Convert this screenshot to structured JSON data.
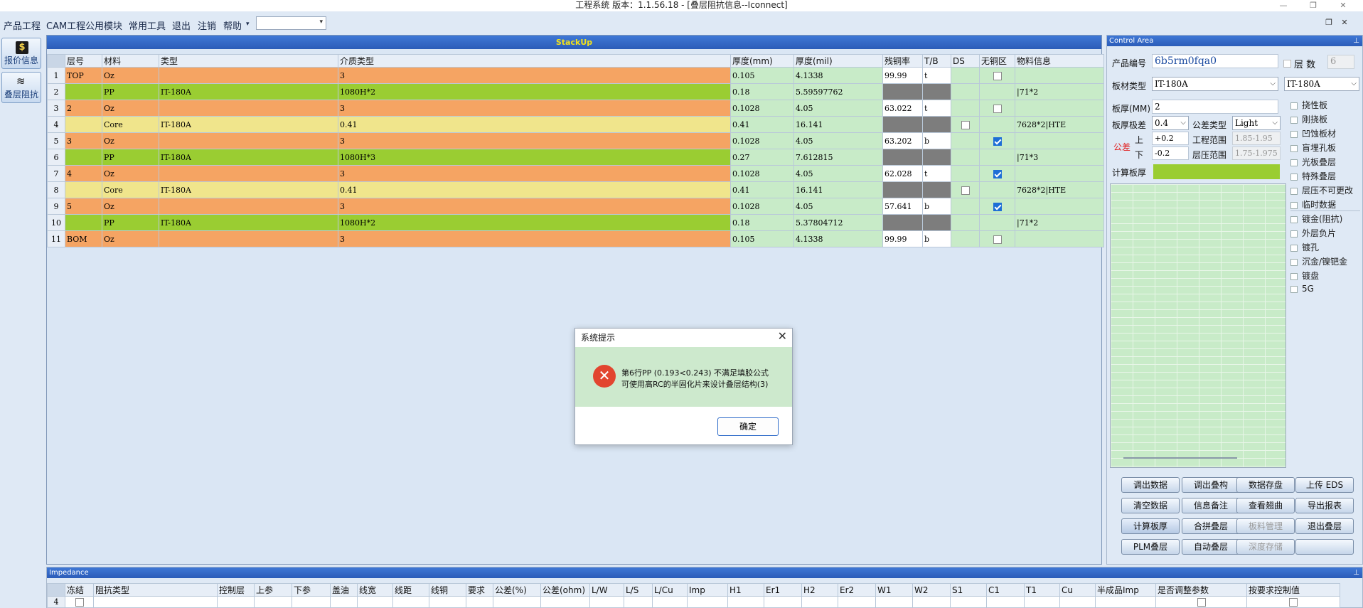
{
  "window": {
    "title": "工程系统   版本：1.1.56.18 - [叠层阻抗信息--Iconnect]",
    "controls": {
      "minimize": "—",
      "restore": "❐",
      "close": "✕"
    }
  },
  "menu": {
    "items": [
      "产品工程",
      "CAM工程",
      "公用模块",
      "常用工具",
      "退出",
      "注销",
      "帮助"
    ],
    "overflow": "▾",
    "combo_value": "",
    "mdi": {
      "restore": "❐",
      "close": "✕"
    }
  },
  "side": {
    "quote_label": "报价信息",
    "quote_icon": "$",
    "stack_label": "叠层阻抗",
    "stack_icon": "≋"
  },
  "stackup": {
    "title": "StackUp",
    "columns": [
      "层号",
      "材料",
      "类型",
      "介质类型",
      "厚度(mm)",
      "厚度(mil)",
      "残铜率",
      "T/B",
      "DS",
      "无铜区",
      "物料信息"
    ],
    "rows": [
      {
        "idx": "1",
        "layer": "TOP",
        "mat": "Oz",
        "type": "",
        "med": "3",
        "mm": "0.105",
        "mil": "4.1338",
        "res": "99.99",
        "tb": "t",
        "ds": "",
        "nocu": "off",
        "info": "",
        "kind": "cu"
      },
      {
        "idx": "2",
        "layer": "",
        "mat": "PP",
        "type": "IT-180A",
        "med": "1080H*2",
        "mm": "0.18",
        "mil": "5.59597762",
        "res": "",
        "tb": "",
        "ds": "",
        "nocu": "",
        "info": "|71*2",
        "kind": "pp"
      },
      {
        "idx": "3",
        "layer": "2",
        "mat": "Oz",
        "type": "",
        "med": "3",
        "mm": "0.1028",
        "mil": "4.05",
        "res": "63.022",
        "tb": "t",
        "ds": "",
        "nocu": "off",
        "info": "",
        "kind": "cu"
      },
      {
        "idx": "4",
        "layer": "",
        "mat": "Core",
        "type": "IT-180A",
        "med": "0.41",
        "mm": "0.41",
        "mil": "16.141",
        "res": "",
        "tb": "",
        "ds": "off",
        "nocu": "",
        "info": "7628*2|HTE",
        "kind": "core"
      },
      {
        "idx": "5",
        "layer": "3",
        "mat": "Oz",
        "type": "",
        "med": "3",
        "mm": "0.1028",
        "mil": "4.05",
        "res": "63.202",
        "tb": "b",
        "ds": "",
        "nocu": "on",
        "info": "",
        "kind": "cu"
      },
      {
        "idx": "6",
        "layer": "",
        "mat": "PP",
        "type": "IT-180A",
        "med": "1080H*3",
        "mm": "0.27",
        "mil": "7.612815",
        "res": "",
        "tb": "",
        "ds": "",
        "nocu": "",
        "info": "|71*3",
        "kind": "pp"
      },
      {
        "idx": "7",
        "layer": "4",
        "mat": "Oz",
        "type": "",
        "med": "3",
        "mm": "0.1028",
        "mil": "4.05",
        "res": "62.028",
        "tb": "t",
        "ds": "",
        "nocu": "on",
        "info": "",
        "kind": "cu"
      },
      {
        "idx": "8",
        "layer": "",
        "mat": "Core",
        "type": "IT-180A",
        "med": "0.41",
        "mm": "0.41",
        "mil": "16.141",
        "res": "",
        "tb": "",
        "ds": "off",
        "nocu": "",
        "info": "7628*2|HTE",
        "kind": "core"
      },
      {
        "idx": "9",
        "layer": "5",
        "mat": "Oz",
        "type": "",
        "med": "3",
        "mm": "0.1028",
        "mil": "4.05",
        "res": "57.641",
        "tb": "b",
        "ds": "",
        "nocu": "on",
        "info": "",
        "kind": "cu"
      },
      {
        "idx": "10",
        "layer": "",
        "mat": "PP",
        "type": "IT-180A",
        "med": "1080H*2",
        "mm": "0.18",
        "mil": "5.37804712",
        "res": "",
        "tb": "",
        "ds": "",
        "nocu": "",
        "info": "|71*2",
        "kind": "pp"
      },
      {
        "idx": "11",
        "layer": "BOM",
        "mat": "Oz",
        "type": "",
        "med": "3",
        "mm": "0.105",
        "mil": "4.1338",
        "res": "99.99",
        "tb": "b",
        "ds": "",
        "nocu": "off",
        "info": "",
        "kind": "cu"
      }
    ]
  },
  "control": {
    "title": "Control Area",
    "pin": "⊥",
    "product_no_label": "产品编号",
    "product_no": "6b5rm0fqa0",
    "layers_label": "层 数",
    "layers_value": "6",
    "board_type_label": "板材类型",
    "board_type": "IT-180A",
    "board_type2": "IT-180A",
    "thickness_label": "板厚(MM)",
    "thickness": "2",
    "tol_level_label": "板厚极差",
    "tol_level": "0.4",
    "tol_type_label": "公差类型",
    "tol_type": "Light",
    "tol_label": "公差",
    "upper_label": "上",
    "upper": "+0.2",
    "lower_label": "下",
    "lower": "-0.2",
    "eng_range_label": "工程范围",
    "eng_range": "1.85-1.95",
    "press_range_label": "层压范围",
    "press_range": "1.75-1.975",
    "calc_label": "计算板厚",
    "options": [
      "挠性板",
      "刚挠板",
      "凹蚀板材",
      "盲埋孔板",
      "光板叠层",
      "特殊叠层",
      "层压不可更改",
      "临时数据",
      "镀金(阻抗)",
      "外层负片",
      "镀孔",
      "沉金/镍钯金",
      "镀盘",
      "5G"
    ],
    "buttons": [
      [
        "调出数据",
        "调出叠构",
        "数据存盘",
        "上传 EDS"
      ],
      [
        "清空数据",
        "信息备注",
        "查看翘曲",
        "导出报表"
      ],
      [
        "计算板厚",
        "合拼叠层",
        "板料管理",
        "退出叠层"
      ],
      [
        "PLM叠层",
        "自动叠层",
        "深度存储",
        ""
      ]
    ]
  },
  "impedance": {
    "title": "Impedance",
    "pin": "⊥",
    "columns": [
      "冻结",
      "阻抗类型",
      "控制层",
      "上参",
      "下参",
      "盖油",
      "线宽",
      "线距",
      "线铜",
      "要求",
      "公差(%)",
      "公差(ohm)",
      "L/W",
      "L/S",
      "L/Cu",
      "Imp",
      "H1",
      "Er1",
      "H2",
      "Er2",
      "W1",
      "W2",
      "S1",
      "C1",
      "T1",
      "Cu",
      "半成品Imp",
      "是否调整参数",
      "按要求控制值"
    ],
    "row_idx": "4"
  },
  "dialog": {
    "title": "系统提示",
    "close": "✕",
    "icon": "✕",
    "line1": "第6行PP (0.193<0.243) 不满足填胶公式",
    "line2": "可使用高RC的半固化片来设计叠层结构(3)",
    "ok": "确定"
  },
  "colors": {
    "copper": "#f5a463",
    "prepreg": "#9acd32",
    "core": "#f0e58c",
    "cell_green": "#c8ebc8",
    "header_blue": "#2b5cb8",
    "error_red": "#e2452f"
  }
}
